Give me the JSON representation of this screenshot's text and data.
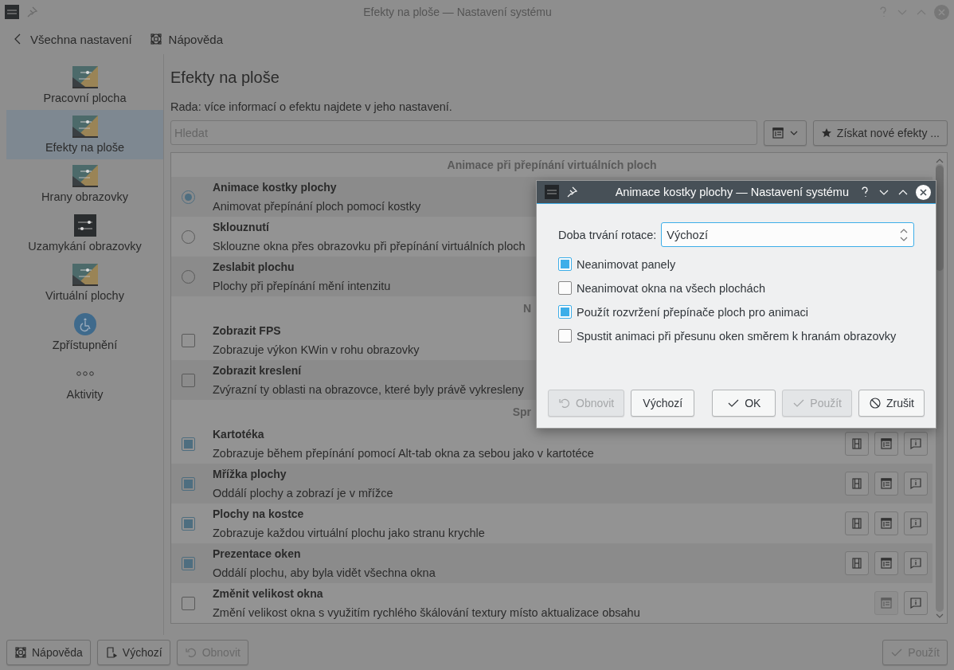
{
  "window": {
    "title": "Efekty na ploše — Nastavení systému"
  },
  "toolbar": [
    {
      "kind": "back",
      "label": "Všechna nastavení"
    },
    {
      "kind": "help",
      "label": "Nápověda"
    }
  ],
  "sidebar": {
    "items": [
      {
        "kind": "desktop",
        "label": "Pracovní plocha",
        "selected": false
      },
      {
        "kind": "desktop",
        "label": "Efekty na ploše",
        "selected": true
      },
      {
        "kind": "desktop",
        "label": "Hrany obrazovky",
        "selected": false
      },
      {
        "kind": "sliders",
        "label": "Uzamykání obrazovky",
        "selected": false
      },
      {
        "kind": "desktop",
        "label": "Virtuální plochy",
        "selected": false
      },
      {
        "kind": "accessibility",
        "label": "Zpřístupnění",
        "selected": false
      },
      {
        "kind": "dots",
        "label": "Aktivity",
        "selected": false
      }
    ]
  },
  "page": {
    "heading": "Efekty na ploše",
    "hint": "Rada: více informací o efektu najdete v jeho nastavení.",
    "search": {
      "placeholder": "Hledat"
    },
    "get_new_button": "Získat nové efekty ..."
  },
  "list": {
    "sections": [
      {
        "title": "Animace při přepínání virtuálních ploch",
        "cut": false,
        "items": [
          {
            "kind": "radio",
            "checked": true,
            "title": "Animace kostky plochy",
            "description": "Animovat přepínání ploch pomocí kostky"
          },
          {
            "kind": "radio",
            "checked": false,
            "title": "Sklouznutí",
            "description": "Sklouzne okna přes obrazovku při přepínání virtuálních ploch"
          },
          {
            "kind": "radio",
            "checked": false,
            "title": "Zeslabit plochu",
            "description": "Plochy při přepínání mění intenzitu"
          }
        ]
      },
      {
        "title": "N",
        "cut": true,
        "items": [
          {
            "kind": "checkbox",
            "checked": false,
            "title": "Zobrazit FPS",
            "description": "Zobrazuje výkon KWin v rohu obrazovky"
          },
          {
            "kind": "checkbox",
            "checked": false,
            "title": "Zobrazit kreslení",
            "description": "Zvýrazní ty oblasti na obrazovce, které byly právě vykresleny"
          }
        ]
      },
      {
        "title": "Spr",
        "cut": true,
        "items": [
          {
            "kind": "checkbox",
            "checked": true,
            "title": "Kartotéka",
            "description": "Zobrazuje během přepínání pomocí Alt-tab okna za sebou jako v kartotéce",
            "buttons": [
              {
                "kind": "video",
                "disabled": false
              },
              {
                "kind": "configure",
                "disabled": false
              },
              {
                "kind": "about",
                "disabled": false
              }
            ]
          },
          {
            "kind": "checkbox",
            "checked": true,
            "title": "Mřížka plochy",
            "description": "Oddálí plochy a zobrazí je v mřížce",
            "buttons": [
              {
                "kind": "video",
                "disabled": false
              },
              {
                "kind": "configure",
                "disabled": false
              },
              {
                "kind": "about",
                "disabled": false
              }
            ]
          },
          {
            "kind": "checkbox",
            "checked": true,
            "title": "Plochy na kostce",
            "description": "Zobrazuje každou virtuální plochu jako stranu krychle",
            "buttons": [
              {
                "kind": "video",
                "disabled": false
              },
              {
                "kind": "configure",
                "disabled": false
              },
              {
                "kind": "about",
                "disabled": false
              }
            ]
          },
          {
            "kind": "checkbox",
            "checked": true,
            "title": "Prezentace oken",
            "description": "Oddálí plochu, aby byla vidět všechna okna",
            "buttons": [
              {
                "kind": "video",
                "disabled": false
              },
              {
                "kind": "configure",
                "disabled": false
              },
              {
                "kind": "about",
                "disabled": false
              }
            ]
          },
          {
            "kind": "checkbox",
            "checked": false,
            "title": "Změnit velikost okna",
            "description": "Změní velikost okna s využitím rychlého škálování textury místo aktualizace obsahu",
            "buttons": [
              {
                "kind": "configure",
                "disabled": true
              },
              {
                "kind": "about",
                "disabled": false
              }
            ]
          }
        ]
      }
    ]
  },
  "bottom_bar": [
    {
      "kind": "help",
      "label": "Nápověda",
      "disabled": false
    },
    {
      "kind": "defaults",
      "label": "Výchozí",
      "disabled": false
    },
    {
      "kind": "reset",
      "label": "Obnovit",
      "disabled": true
    },
    {
      "kind": "apply",
      "label": "Použít",
      "disabled": true
    }
  ],
  "dialog": {
    "title": "Animace kostky plochy — Nastavení systému",
    "field": {
      "label": "Doba trvání rotace:",
      "value": "Výchozí"
    },
    "options": [
      {
        "label": "Neanimovat panely",
        "checked": true
      },
      {
        "label": "Neanimovat okna na všech plochách",
        "checked": false
      },
      {
        "label": "Použít rozvržení přepínače ploch pro animaci",
        "checked": true
      },
      {
        "label": "Spustit animaci při přesunu oken směrem k hranám obrazovky",
        "checked": false
      }
    ],
    "buttons": [
      {
        "kind": "reset",
        "label": "Obnovit",
        "disabled": true
      },
      {
        "kind": "defaults",
        "label": "Výchozí",
        "disabled": false
      },
      {
        "kind": "ok",
        "label": "OK",
        "disabled": false
      },
      {
        "kind": "apply",
        "label": "Použít",
        "disabled": true
      },
      {
        "kind": "cancel",
        "label": "Zrušit",
        "disabled": false
      }
    ]
  }
}
